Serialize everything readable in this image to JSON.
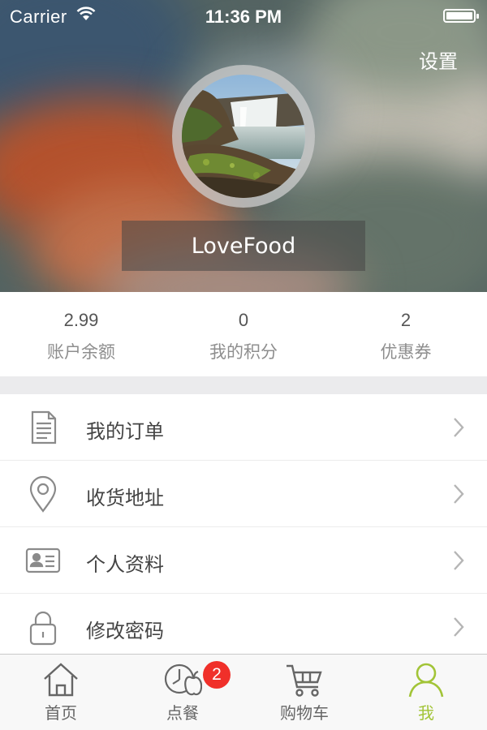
{
  "status_bar": {
    "carrier": "Carrier",
    "time": "11:36 PM",
    "battery_level": 1.0
  },
  "header": {
    "settings_label": "设置",
    "username": "LoveFood",
    "avatar_icon": "waterfall-photo"
  },
  "stats": [
    {
      "value": "2.99",
      "label": "账户余额"
    },
    {
      "value": "0",
      "label": "我的积分"
    },
    {
      "value": "2",
      "label": "优惠券"
    }
  ],
  "menu": [
    {
      "label": "我的订单",
      "icon": "document-icon"
    },
    {
      "label": "收货地址",
      "icon": "location-pin-icon"
    },
    {
      "label": "个人资料",
      "icon": "id-card-icon"
    },
    {
      "label": "修改密码",
      "icon": "lock-icon"
    }
  ],
  "tabbar": {
    "tabs": [
      {
        "label": "首页",
        "icon": "home-icon"
      },
      {
        "label": "点餐",
        "icon": "clock-apple-icon"
      },
      {
        "label": "购物车",
        "icon": "cart-icon"
      },
      {
        "label": "我",
        "icon": "user-icon"
      }
    ],
    "cart_badge": "2",
    "active_tab": "我"
  },
  "colors": {
    "accent": "#a2c437",
    "badge": "#f0302a",
    "text_primary": "#444444",
    "text_secondary": "#8e8e8e",
    "divider": "#ebebed"
  }
}
